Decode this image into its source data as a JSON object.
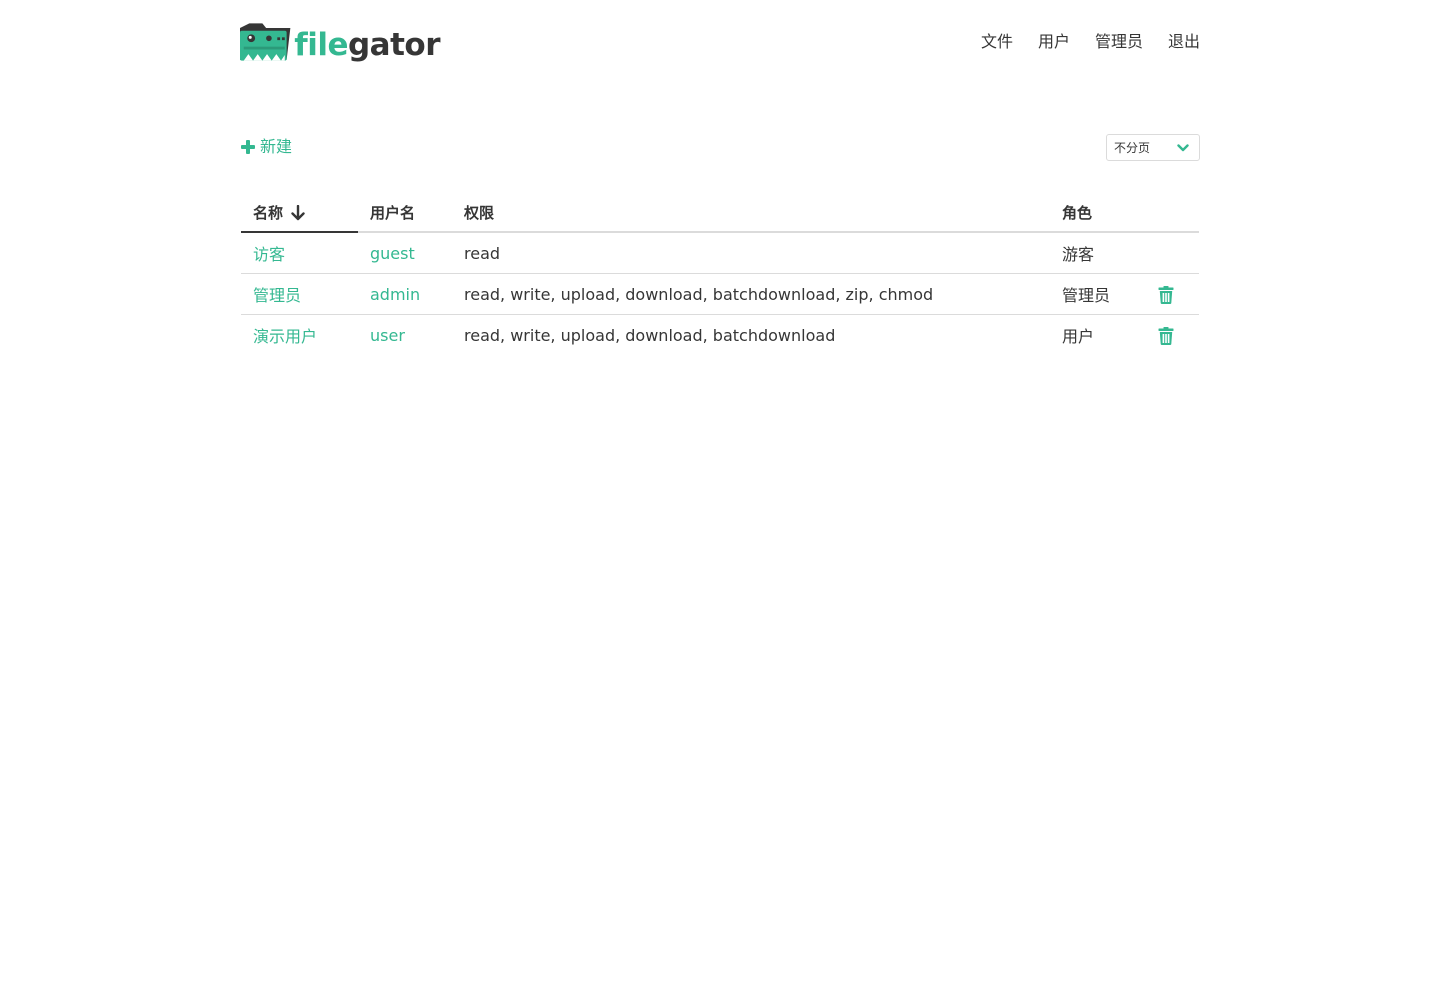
{
  "app": {
    "logo": {
      "part1": "file",
      "part2": "gator"
    }
  },
  "nav": {
    "items": [
      "文件",
      "用户",
      "管理员",
      "退出"
    ]
  },
  "toolbar": {
    "add_label": "新建",
    "per_page": "不分页"
  },
  "table": {
    "headers": {
      "name": "名称",
      "username": "用户名",
      "permissions": "权限",
      "role": "角色"
    },
    "rows": [
      {
        "name": "访客",
        "username": "guest",
        "permissions": "read",
        "role": "游客",
        "deletable": false
      },
      {
        "name": "管理员",
        "username": "admin",
        "permissions": "read, write, upload, download, batchdownload, zip, chmod",
        "role": "管理员",
        "deletable": true
      },
      {
        "name": "演示用户",
        "username": "user",
        "permissions": "read, write, upload, download, batchdownload",
        "role": "用户",
        "deletable": true
      }
    ]
  },
  "colors": {
    "accent": "#34b891",
    "text": "#363636",
    "border": "#dbdbdb"
  },
  "icons": {
    "add": "plus-icon",
    "sort": "arrow-down-icon",
    "select": "chevron-down-icon",
    "delete": "trash-icon"
  }
}
